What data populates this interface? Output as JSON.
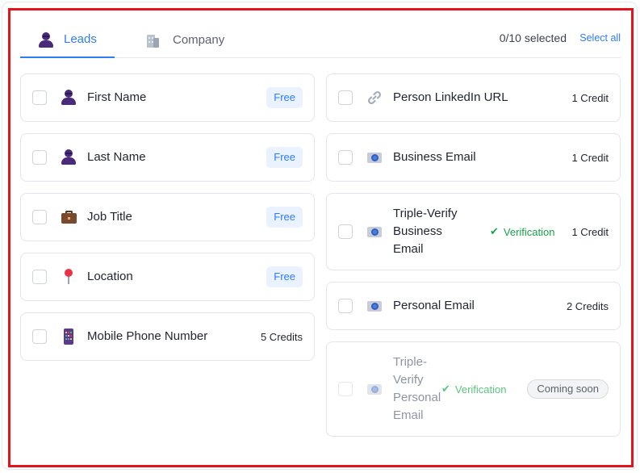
{
  "header": {
    "tabs": [
      {
        "label": "Leads",
        "icon": "person-icon",
        "active": true
      },
      {
        "label": "Company",
        "icon": "building-icon",
        "active": false
      }
    ],
    "selected_count": "0/10 selected",
    "select_all_label": "Select all"
  },
  "left_fields": [
    {
      "label": "First Name",
      "icon": "person-icon",
      "cost": "Free"
    },
    {
      "label": "Last Name",
      "icon": "person-icon",
      "cost": "Free"
    },
    {
      "label": "Job Title",
      "icon": "briefcase-icon",
      "cost": "Free"
    },
    {
      "label": "Location",
      "icon": "pin-icon",
      "cost": "Free"
    },
    {
      "label": "Mobile Phone Number",
      "icon": "phone-icon",
      "cost": "5 Credits"
    }
  ],
  "right_fields": [
    {
      "label": "Person LinkedIn URL",
      "icon": "link-icon",
      "cost": "1 Credit"
    },
    {
      "label": "Business Email",
      "icon": "email-icon",
      "cost": "1 Credit"
    },
    {
      "label_lines": [
        "Triple-Verify",
        "Business",
        "Email"
      ],
      "icon": "email-icon",
      "verification": "Verification",
      "cost": "1 Credit"
    },
    {
      "label": "Personal Email",
      "icon": "email-icon",
      "cost": "2 Credits"
    },
    {
      "label_lines": [
        "Triple-",
        "Verify",
        "Personal",
        "Email"
      ],
      "icon": "email-icon",
      "verification": "Verification",
      "status": "Coming soon",
      "disabled": true
    }
  ],
  "colors": {
    "accent": "#2f7cf6",
    "verification_green": "#17a34a",
    "highlight_frame": "#e3141b"
  }
}
